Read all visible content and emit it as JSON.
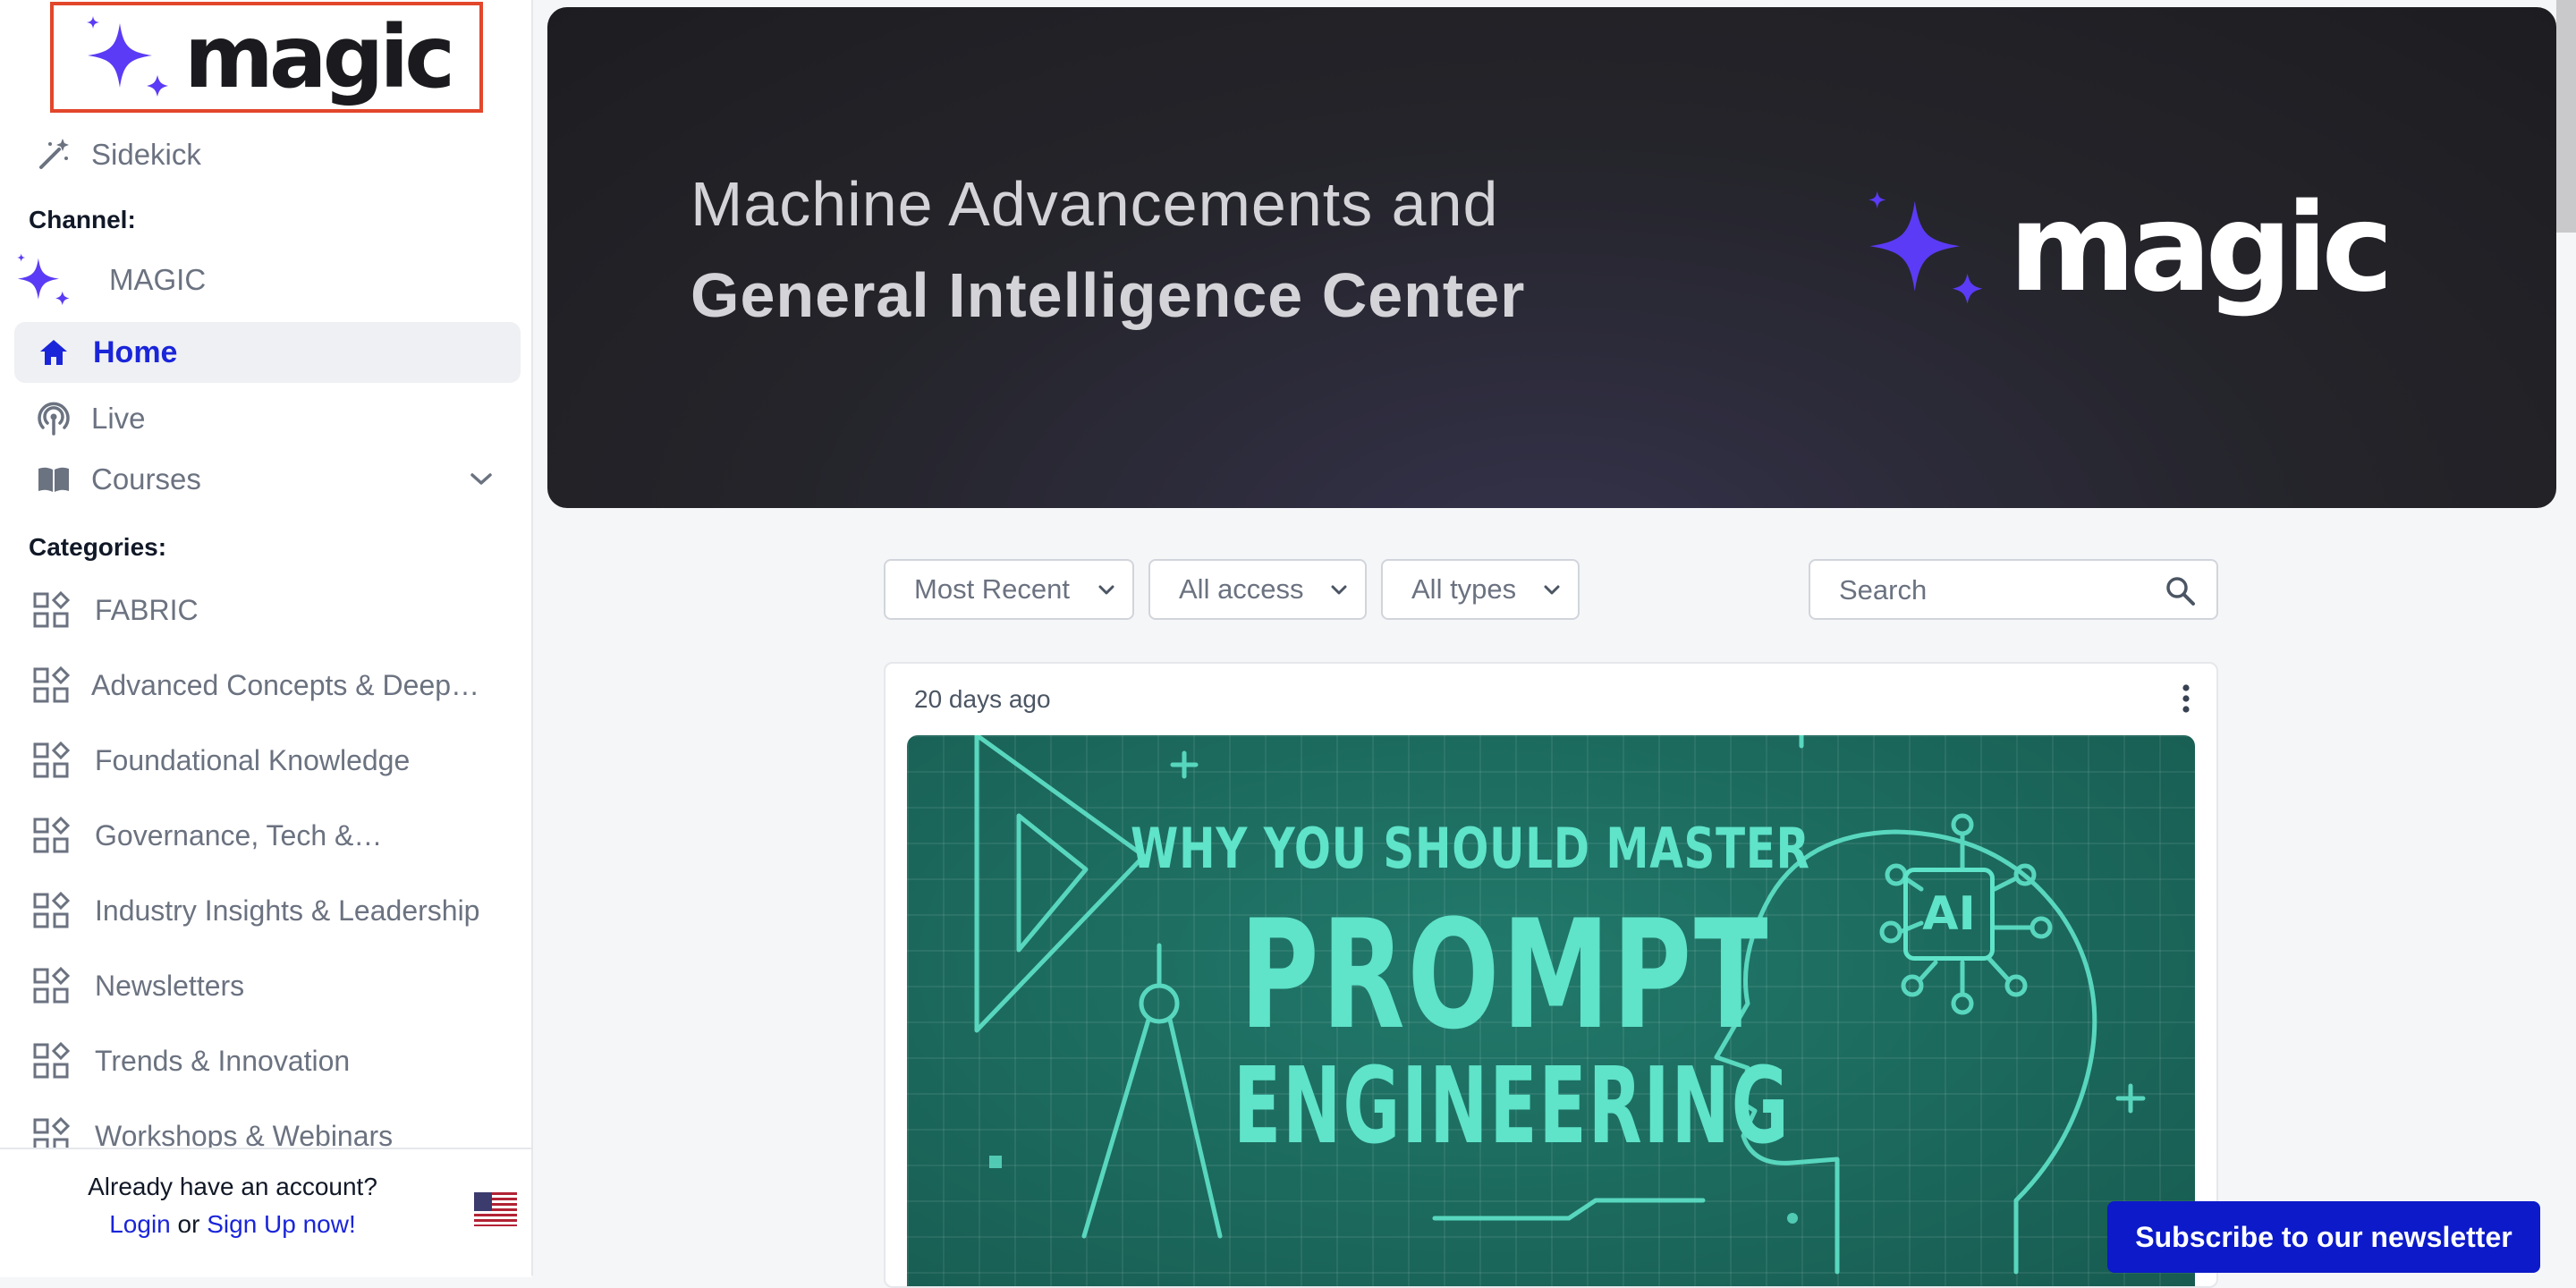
{
  "brand": {
    "logo_text": "magic",
    "accent": "#5b3bf5"
  },
  "sidebar": {
    "sidekick_label": "Sidekick",
    "channel_title": "Channel:",
    "channel_name": "MAGIC",
    "nav": {
      "home": "Home",
      "live": "Live",
      "courses": "Courses"
    },
    "categories_title": "Categories:",
    "categories": [
      "FABRIC",
      "Advanced Concepts & Deep…",
      "Foundational Knowledge",
      "Governance, Tech &…",
      "Industry Insights & Leadership",
      "Newsletters",
      "Trends & Innovation",
      "Workshops & Webinars"
    ],
    "footer": {
      "question": "Already have an account?",
      "login": "Login",
      "or": "or",
      "signup": "Sign Up now!"
    }
  },
  "banner": {
    "line1": "Machine Advancements and",
    "line2": "General Intelligence Center",
    "logo_text": "magic"
  },
  "filters": {
    "sort": "Most Recent",
    "access": "All access",
    "types": "All types",
    "search_placeholder": "Search"
  },
  "card": {
    "date": "20 days ago",
    "thumb": {
      "line1": "WHY YOU SHOULD MASTER",
      "line2": "PROMPT",
      "line3": "ENGINEERING",
      "chip": "AI"
    }
  },
  "newsletter_button": "Subscribe to our newsletter",
  "colors": {
    "link": "#1a25d9",
    "cta": "#0c1ac9",
    "teal": "#5fe3c9"
  }
}
